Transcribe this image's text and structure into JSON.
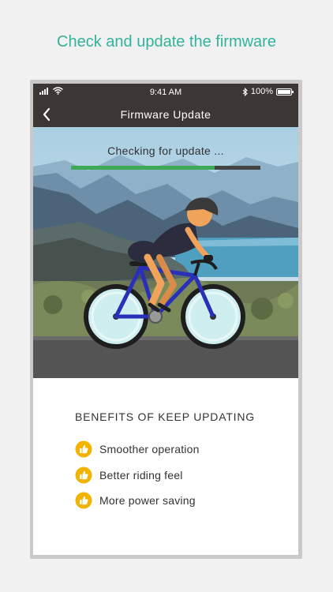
{
  "headline": "Check and update the firmware",
  "status_bar": {
    "time": "9:41 AM",
    "battery": "100%",
    "icons": [
      "signal-icon",
      "wifi-icon",
      "bluetooth-icon",
      "battery-icon"
    ]
  },
  "nav": {
    "title": "Firmware Update",
    "back_icon": "chevron-left-icon"
  },
  "update": {
    "status_text": "Checking for update ...",
    "progress": 0.76
  },
  "benefits": {
    "title": "BENEFITS OF KEEP UPDATING",
    "items": [
      {
        "label": "Smoother operation",
        "icon": "thumbs-up-icon"
      },
      {
        "label": "Better riding feel",
        "icon": "thumbs-up-icon"
      },
      {
        "label": "More power saving",
        "icon": "thumbs-up-icon"
      }
    ]
  },
  "colors": {
    "accent": "#33b39a",
    "bar_bg": "#3b3734",
    "progress": "#3eaa56",
    "icon": "#f2b400"
  }
}
